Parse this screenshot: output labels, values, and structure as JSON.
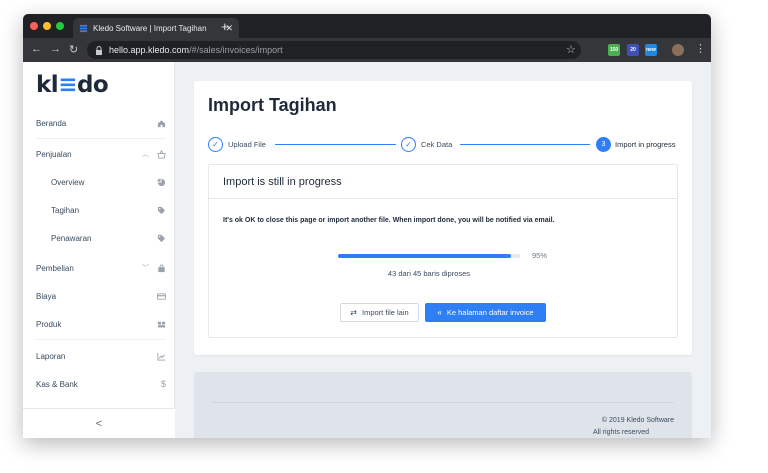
{
  "browser": {
    "tab_title": "Kledo Software | Import Tagihan",
    "url_host": "hello.app.kledo.com",
    "url_path": "/#/sales/invoices/import",
    "extensions": [
      {
        "name": "ext-1",
        "label": "150",
        "color": "#4caf50"
      },
      {
        "name": "ext-2",
        "label": "20",
        "color": "#3f51b5"
      },
      {
        "name": "ext-3",
        "label": "new",
        "color": "#1e88e5"
      }
    ]
  },
  "sidebar": {
    "logo_prefix": "kl",
    "logo_accent": "≡",
    "logo_suffix": "do",
    "items": [
      {
        "label": "Beranda",
        "icon": "home-icon"
      },
      {
        "label": "Penjualan",
        "icon": "basket-icon",
        "expanded": true
      },
      {
        "label": "Overview",
        "icon": "pie-chart-icon"
      },
      {
        "label": "Tagihan",
        "icon": "tags-icon"
      },
      {
        "label": "Penawaran",
        "icon": "tag-icon"
      },
      {
        "label": "Pembelian",
        "icon": "bag-icon"
      },
      {
        "label": "Biaya",
        "icon": "credit-card-icon"
      },
      {
        "label": "Produk",
        "icon": "box-icon"
      },
      {
        "label": "Laporan",
        "icon": "line-chart-icon"
      },
      {
        "label": "Kas & Bank",
        "icon": "dollar-icon"
      }
    ],
    "collapse_label": "<"
  },
  "main": {
    "title": "Import Tagihan",
    "steps": [
      {
        "label": "Upload File",
        "state": "done"
      },
      {
        "label": "Cek Data",
        "state": "done"
      },
      {
        "label": "Import in progress",
        "state": "active",
        "number": "3"
      }
    ],
    "status_title": "Import is still in progress",
    "notice": "It's ok OK to close this page or import another file. When import done, you will be notified via email.",
    "progress_percent": 95,
    "progress_label": "95%",
    "progress_caption": "43 dari 45 baris diproses",
    "btn_import_other": "Import file lain",
    "btn_invoice_list": "Ke halaman daftar invoice"
  },
  "footer": {
    "copyright": "© 2019 Kledo Software",
    "rights": "All rights reserved"
  },
  "colors": {
    "accent": "#2e7ef5",
    "sidebar_bg": "#ffffff",
    "content_bg": "#eef1f4"
  }
}
